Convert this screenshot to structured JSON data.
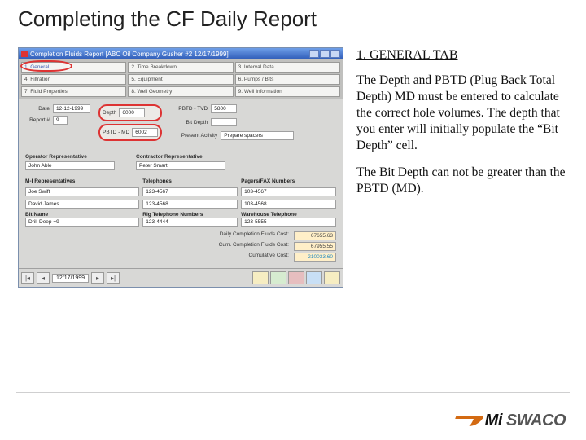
{
  "title": "Completing the CF Daily Report",
  "explain": {
    "heading": "1. GENERAL TAB",
    "p1": "The Depth and PBTD (Plug Back Total Depth) MD must be entered to calculate the correct hole volumes. The depth that you enter will initially populate the “Bit Depth” cell.",
    "p2": "The Bit Depth can not be greater than the PBTD (MD)."
  },
  "window": {
    "title": "Completion Fluids Report [ABC Oil Company  Gusher #2  12/17/1999]",
    "tabs": [
      "1. General",
      "2. Time Breakdown",
      "3. Interval Data",
      "4. Filtration",
      "5. Equipment",
      "6. Pumps / Bits",
      "7. Fluid Properties",
      "8. Well Geometry",
      "9. Well Information"
    ],
    "date_label": "Date",
    "date": "12-12-1999",
    "report_label": "Report #",
    "report": "9",
    "depth_label": "Depth",
    "depth": "6000",
    "pbtd_tvd_label": "PBTD - TVD",
    "pbtd_tvd": "5800",
    "bit_depth_label": "Bit Depth",
    "bit_depth": "",
    "pbtd_md_label": "PBTD - MD",
    "pbtd_md": "6002",
    "present_activity_label": "Present Activity",
    "present_activity": "Prepare spacers",
    "reps": {
      "op_label": "Operator Representative",
      "op": "John Able",
      "con_label": "Contractor Representative",
      "con": "Peter Smart"
    },
    "cols": {
      "rep_h": "M-I Representatives",
      "rep1": "Joe Swift",
      "rep2": "David James",
      "tel_h": "Telephones",
      "tel1": "123-4567",
      "tel2": "123-4568",
      "fax_h": "Pagers/FAX Numbers",
      "fax1": "103-4567",
      "fax2": "103-4568",
      "bit_name_label": "Bit Name",
      "bit_name": "Drill Deep +9",
      "rig_tel_label": "Rig Telephone Numbers",
      "rig_tel": "123-4444",
      "wh_tel_label": "Warehouse Telephone",
      "wh_tel": "123-5555"
    },
    "totals": {
      "daily_l": "Daily Completion Fluids Cost:",
      "daily": "67655.63",
      "cum_l": "Cum. Completion Fluids Cost:",
      "cum": "67955.55",
      "sum_l": "Cumulative Cost:",
      "sum": "210033.60"
    },
    "nav_date": "12/17/1999"
  },
  "logo": {
    "a": "Mi",
    "b": "SWACO"
  }
}
